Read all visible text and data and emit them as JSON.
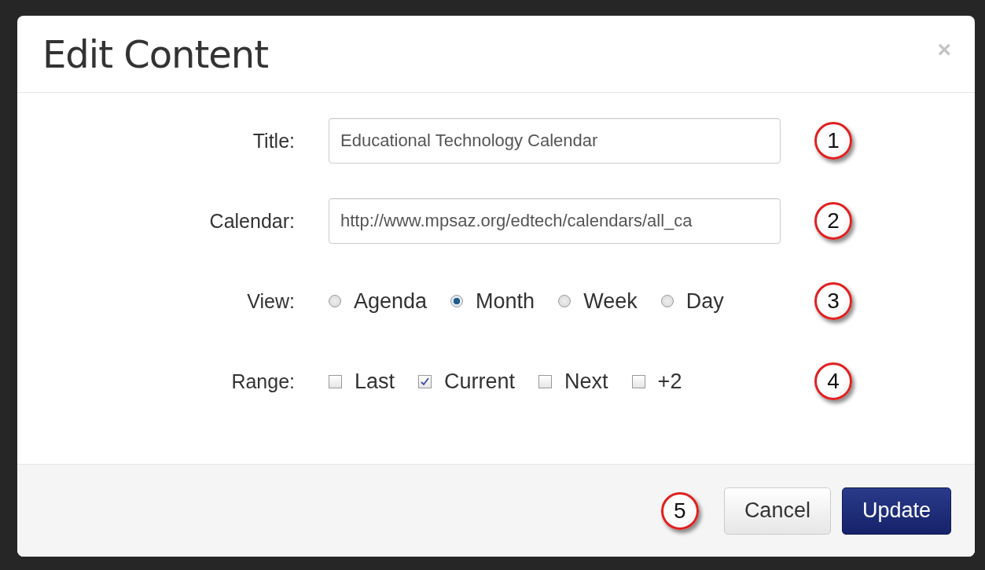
{
  "dialog": {
    "title": "Edit Content",
    "close": "×"
  },
  "fields": [
    {
      "kind": "text",
      "label": "Title:",
      "value": "Educational Technology Calendar",
      "callout": "1"
    },
    {
      "kind": "text",
      "label": "Calendar:",
      "value": "http://www.mpsaz.org/edtech/calendars/all_ca",
      "callout": "2"
    },
    {
      "kind": "radio",
      "label": "View:",
      "options": [
        {
          "label": "Agenda",
          "selected": false
        },
        {
          "label": "Month",
          "selected": true
        },
        {
          "label": "Week",
          "selected": false
        },
        {
          "label": "Day",
          "selected": false
        }
      ],
      "callout": "3"
    },
    {
      "kind": "checkbox",
      "label": "Range:",
      "options": [
        {
          "label": "Last",
          "checked": false
        },
        {
          "label": "Current",
          "checked": true
        },
        {
          "label": "Next",
          "checked": false
        },
        {
          "label": "+2",
          "checked": false
        }
      ],
      "callout": "4"
    }
  ],
  "footer": {
    "callout": "5",
    "buttons": [
      {
        "label": "Cancel",
        "kind": "default"
      },
      {
        "label": "Update",
        "kind": "primary"
      }
    ]
  }
}
